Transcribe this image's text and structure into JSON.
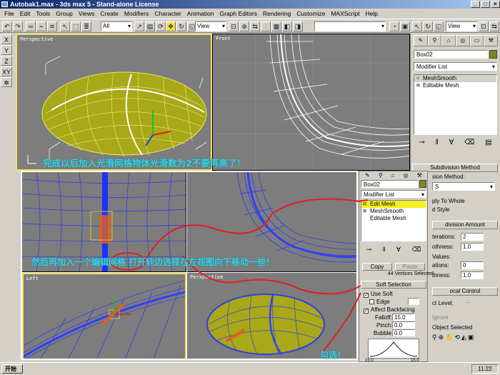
{
  "window": {
    "title": "Autobak1.max - 3ds max 5 - Stand-alone License"
  },
  "menu": [
    "File",
    "Edit",
    "Tools",
    "Group",
    "Views",
    "Create",
    "Modifiers",
    "Character",
    "Animation",
    "Graph Editors",
    "Rendering",
    "Customize",
    "MAXScript",
    "Help"
  ],
  "toolbar": {
    "selection_filter": "All",
    "ref_coord": "View",
    "ref_coord_right": "View"
  },
  "left_tools": [
    "X",
    "Y",
    "Z",
    "XY",
    "✲"
  ],
  "viewports": {
    "perspective": "Perspective",
    "front": "Front",
    "left": "Left"
  },
  "command_panel": {
    "object_name": "Box02",
    "modifier_list": "Modifier List",
    "stack": [
      "MeshSmooth",
      "Editable Mesh"
    ],
    "subdivision_method_title": "Subdivision Method",
    "subdivision_method_label": "sion Method:",
    "subdivision_method_value": "S",
    "apply_to_whole": "ply To Whole",
    "old_style": "d Style",
    "subdivision_amount_title": "division Amount",
    "iterations_label": "terations:",
    "iterations_value": "2",
    "smoothness_label": "othness:",
    "smoothness_value": "1.0",
    "render_values": "Values:",
    "render_iter_label": "ations:",
    "render_iter_value": "0",
    "render_smooth_label": "thness:",
    "render_smooth_value": "1.0",
    "local_control_title": "ocal Control",
    "object_level": "ct Level:",
    "ignore": "Ignore",
    "object_selected": "Object Selected"
  },
  "overlay_panel": {
    "object_name": "Box02",
    "modifier_list": "Modifier List",
    "stack": [
      "Edit Mesh",
      "MeshSmooth",
      "Editable Mesh"
    ],
    "copy": "Copy",
    "paste": "Paste",
    "vertices_selected": "44 Vertices Selected",
    "soft_selection_title": "Soft Selection",
    "use_soft": "Use Soft",
    "edge": "Edge",
    "affect_backfacing": "Affect Backfacing",
    "falloff_label": "Falloff:",
    "falloff_value": "15.0",
    "pinch_label": "Pinch:",
    "pinch_value": "0.0",
    "bubble_label": "Bubble:",
    "bubble_value": "0.0",
    "graph_left": "15.0",
    "graph_right": "15.0"
  },
  "annotations": {
    "line1": "完成以后加入光滑网格物体光滑数为2不要再高了！",
    "line2": "然后再加入一个编辑网格 打开软边选择在左视图向下移动一些！",
    "check": "勾选！"
  },
  "taskbar": {
    "start": "开始",
    "clock": "11:22"
  },
  "colors": {
    "title_bar": "#0a246a",
    "viewport_bg": "#7d7d7d",
    "selected_vp": "#f0e060",
    "mesh_yellow": "#a8a818",
    "annotation": "#38d8e8",
    "red_line": "#e02020"
  }
}
